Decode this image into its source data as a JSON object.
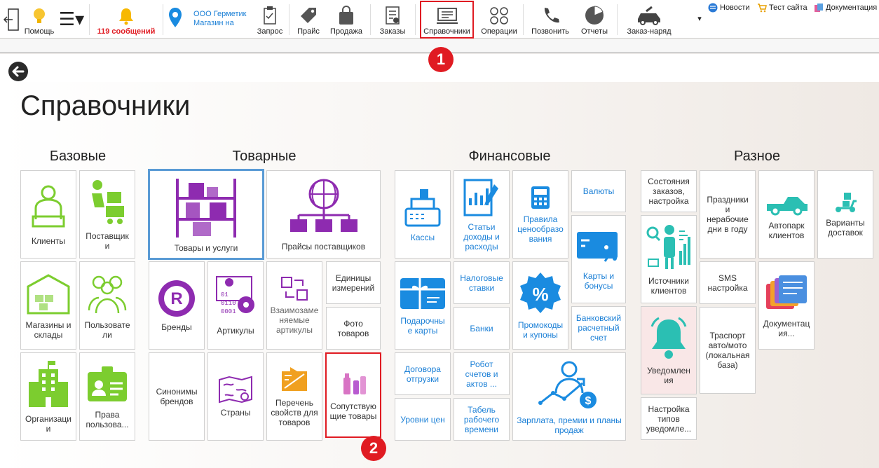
{
  "toolbar": {
    "help": "Помощь",
    "menu_glyph": "☰▾",
    "messages": "119 сообщений",
    "company_line1": "ООО Герметик",
    "company_line2": "Магазин на",
    "request": "Запрос",
    "price": "Прайс",
    "sale": "Продажа",
    "orders": "Заказы",
    "references": "Справочники",
    "operations": "Операции",
    "call": "Позвонить",
    "reports": "Отчеты",
    "work_order": "Заказ-наряд",
    "more_glyph": "▾",
    "links": {
      "news": "Новости",
      "test_site": "Тест сайта",
      "docs": "Документация"
    }
  },
  "badges": {
    "first": "1",
    "second": "2"
  },
  "page": {
    "title": "Справочники"
  },
  "groups": {
    "basic": "Базовые",
    "goods": "Товарные",
    "finance": "Финансовые",
    "misc": "Разное"
  },
  "tiles": {
    "clients": "Клиенты",
    "suppliers": "Поставщик\nи",
    "stores": "Магазины и\nсклады",
    "users": "Пользовате\nли",
    "organizations": "Организаци\nи",
    "permissions": "Права\nпользова...",
    "goods_services": "Товары и услуги",
    "supplier_prices": "Прайсы поставщиков",
    "brands": "Бренды",
    "articles": "Артикулы",
    "interchangeable": "Взаимозаме\nняемые\nартикулы",
    "units": "Единицы\nизмерений",
    "photos": "Фото\nтоваров",
    "brand_synonyms": "Синонимы\nбрендов",
    "countries": "Страны",
    "properties": "Перечень\nсвойств для\nтоваров",
    "related_goods": "Сопутствую\nщие товары",
    "cashboxes": "Кассы",
    "income_expense": "Статьи\nдоходы и\nрасходы",
    "pricing_rules": "Правила\nценообразо\nвания",
    "currencies": "Валюты",
    "cards_bonuses": "Карты и\nбонусы",
    "gift_cards": "Подарочны\nе карты",
    "tax_rates": "Налоговые\nставки",
    "banks": "Банки",
    "promo_codes": "Промокоды\nи купоны",
    "bank_account": "Банковский\nрасчетный\nсчет",
    "shipping_contracts": "Договора\nотгрузки",
    "price_levels": "Уровни цен",
    "invoice_robot": "Робот\nсчетов и\nактов ...",
    "timesheet": "Табель\nрабочего\nвремени",
    "salary": "Зарплата, премии и планы\nпродаж",
    "order_states": "Состояния\nзаказов,\nнастройка",
    "holidays": "Праздники\nи\nнерабочие\nдни в году",
    "client_fleet": "Автопарк\nклиентов",
    "delivery_options": "Варианты\nдоставок",
    "client_sources": "Источники\nклиентов",
    "sms_settings": "SMS\nнастройка",
    "transport_db": "Траспорт\nавто/мото\n(локальная\nбаза)",
    "documentation": "Документац\nия...",
    "notifications": "Уведомлен\nия",
    "notification_types": "Настройка\nтипов\nуведомле..."
  },
  "colors": {
    "green": "#7ccd2f",
    "purple": "#8e2bb0",
    "blue": "#1a8be0",
    "teal": "#2bbfb3",
    "red": "#e01b22",
    "orange": "#f0a020"
  }
}
